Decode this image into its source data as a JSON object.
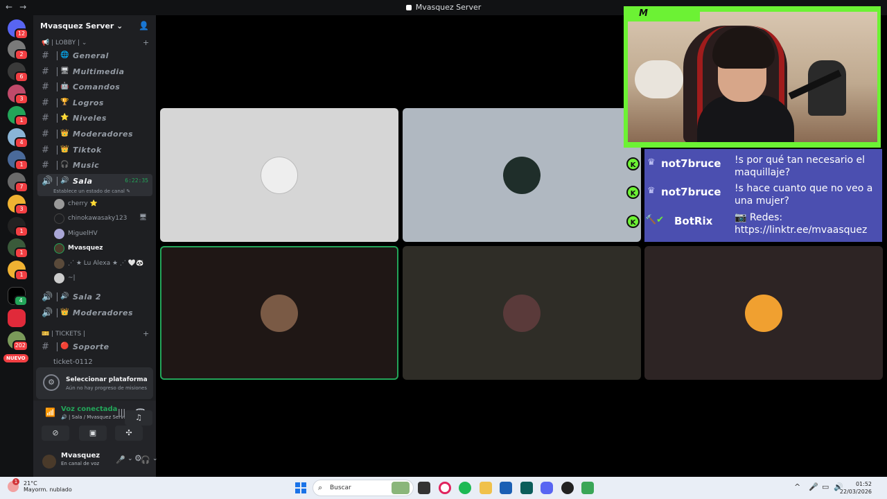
{
  "window": {
    "title": "Mvasquez Server"
  },
  "nav": {
    "back": "←",
    "forward": "→"
  },
  "server": {
    "name": "Mvasquez Server ⌄"
  },
  "rail": {
    "badges": [
      "12",
      "2",
      "6",
      "3",
      "1",
      "4",
      "1",
      "7",
      "3",
      "1",
      "1",
      "1",
      "4",
      "202"
    ],
    "nuevo": "NUEVO"
  },
  "categories": {
    "lobby": "📢 | LOBBY | ⌄",
    "tickets": "🎫 | TICKETS |"
  },
  "channels": [
    {
      "emoji": "🌐",
      "label": "General"
    },
    {
      "emoji": "🖥",
      "label": "Multimedia"
    },
    {
      "emoji": "🤖",
      "label": "Comandos"
    },
    {
      "emoji": "🏆",
      "label": "Logros"
    },
    {
      "emoji": "⭐",
      "label": "Niveles"
    },
    {
      "emoji": "👑",
      "label": "Moderadores"
    },
    {
      "emoji": "👑",
      "label": "Tiktok"
    },
    {
      "emoji": "🎧",
      "label": "Music"
    }
  ],
  "voice_channel": {
    "label": "Sala",
    "time": "6:22:35",
    "status": "Establece un estado de canal ✎"
  },
  "voice_users": [
    "cherry ⭐",
    "chinokawasaky123",
    "MiguelHV",
    "Mvasquez",
    "⋰ ★ Lu Alexa ★ ⋰ 🤍🐼",
    "~|"
  ],
  "other_voice": [
    {
      "emoji": "🔊",
      "label": "Sala 2"
    },
    {
      "emoji": "👑",
      "label": "Moderadores"
    }
  ],
  "soporte": {
    "emoji": "🔴",
    "label": "Soporte"
  },
  "ticket": "ticket-0112",
  "quest": {
    "title": "Seleccionar plataforma",
    "subtitle": "Aún no hay progreso de misiones"
  },
  "voice_status": {
    "title": "Voz conectada",
    "subtitle": "🔊 | Sala / Mvasquez Server"
  },
  "user": {
    "name": "Mvasquez",
    "status": "En canal de voz"
  },
  "overlay": {
    "tag": "M",
    "chat": [
      {
        "user": "not7bruce",
        "msg": "!s por qué tan necesario el maquillaje?"
      },
      {
        "user": "not7bruce",
        "msg": "!s hace cuanto que no veo a una mujer?"
      },
      {
        "user": "BotRix",
        "msg": "📷 Redes: https://linktr.ee/mvaasquez"
      }
    ]
  },
  "taskbar": {
    "temp": "21°C",
    "weather": "Mayorm. nublado",
    "search_placeholder": "Buscar",
    "time": "01:52",
    "date": "22/03/2026"
  },
  "colors": {
    "accent_green": "#23a559",
    "overlay_green": "#6cf234",
    "chat_bg": "#4b4fb0",
    "danger": "#f23f43"
  }
}
